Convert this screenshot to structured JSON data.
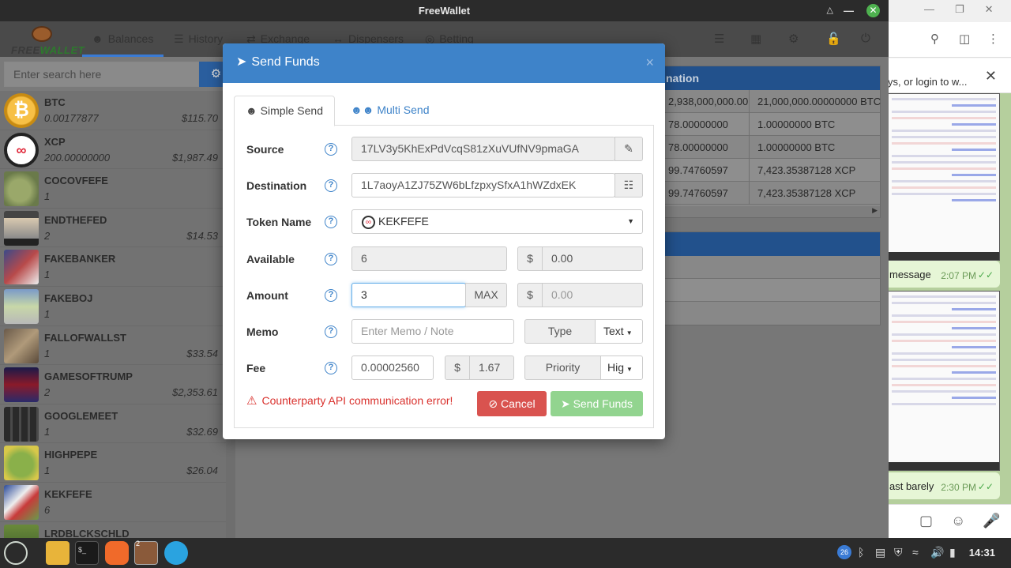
{
  "window": {
    "title": "FreeWallet"
  },
  "logo": {
    "text_free": "FREE",
    "text_wallet": "WALLET"
  },
  "nav": {
    "tabs": [
      {
        "label": "Balances",
        "icon": "user-icon"
      },
      {
        "label": "History",
        "icon": "list-icon"
      },
      {
        "label": "Exchange",
        "icon": "exchange-icon"
      },
      {
        "label": "Dispensers",
        "icon": "arrows-h-icon"
      },
      {
        "label": "Betting",
        "icon": "target-icon"
      }
    ]
  },
  "search": {
    "placeholder": "Enter search here"
  },
  "assets": [
    {
      "name": "BTC",
      "qty": "0.00177877",
      "usd": "$115.70"
    },
    {
      "name": "XCP",
      "qty": "200.00000000",
      "usd": "$1,987.49"
    },
    {
      "name": "COCOVFEFE",
      "qty": "1",
      "usd": ""
    },
    {
      "name": "ENDTHEFED",
      "qty": "2",
      "usd": "$14.53"
    },
    {
      "name": "FAKEBANKER",
      "qty": "1",
      "usd": ""
    },
    {
      "name": "FAKEBOJ",
      "qty": "1",
      "usd": ""
    },
    {
      "name": "FALLOFWALLST",
      "qty": "1",
      "usd": "$33.54"
    },
    {
      "name": "GAMESOFTRUMP",
      "qty": "2",
      "usd": "$2,353.61"
    },
    {
      "name": "GOOGLEMEET",
      "qty": "1",
      "usd": "$32.69"
    },
    {
      "name": "HIGHPEPE",
      "qty": "1",
      "usd": "$26.04"
    },
    {
      "name": "KEKFEFE",
      "qty": "6",
      "usd": ""
    },
    {
      "name": "LRDBLCKSCHLD",
      "qty": "",
      "usd": ""
    }
  ],
  "main": {
    "panel1_title": "nation",
    "rows": [
      {
        "c1": "2,938,000,000.00",
        "c2": "21,000,000.00000000 BTC"
      },
      {
        "c1": "78.00000000",
        "c2": "1.00000000 BTC"
      },
      {
        "c1": "78.00000000",
        "c2": "1.00000000 BTC"
      },
      {
        "c1": "99.74760597",
        "c2": "7,423.35387128 XCP"
      },
      {
        "c1": "99.74760597",
        "c2": "7,423.35387128 XCP"
      }
    ]
  },
  "modal": {
    "title": "Send Funds",
    "tab_simple": "Simple Send",
    "tab_multi": "Multi Send",
    "source_label": "Source",
    "source_value": "17LV3y5KhExPdVcqS81zXuVUfNV9pmaGA",
    "destination_label": "Destination",
    "destination_value": "1L7aoyA1ZJ75ZW6bLfzpxySfxA1hWZdxEK",
    "token_label": "Token Name",
    "token_value": "KEKFEFE",
    "available_label": "Available",
    "available_value": "6",
    "available_usd": "0.00",
    "amount_label": "Amount",
    "amount_value": "3",
    "max_label": "MAX",
    "amount_usd_placeholder": "0.00",
    "memo_label": "Memo",
    "memo_placeholder": "Enter Memo / Note",
    "type_label": "Type",
    "type_value": "Text",
    "fee_label": "Fee",
    "fee_value": "0.00002560",
    "fee_usd": "1.67",
    "priority_label": "Priority",
    "priority_value": "Hig",
    "error": "Counterparty API communication error!",
    "cancel": "Cancel",
    "send": "Send Funds",
    "help": "?",
    "dollar": "$"
  },
  "chat": {
    "banner": "ys, or login to w...",
    "messages": [
      {
        "text": "message",
        "time": "2:07 PM"
      },
      {
        "text": "ast barely",
        "time": "2:30 PM"
      }
    ]
  },
  "taskbar": {
    "time": "14:31",
    "badge": "26",
    "app_badge": "2"
  },
  "colors": {
    "primary": "#3e83c9",
    "danger": "#d9534f",
    "success": "#92d48f",
    "panel_head": "#22518c"
  }
}
